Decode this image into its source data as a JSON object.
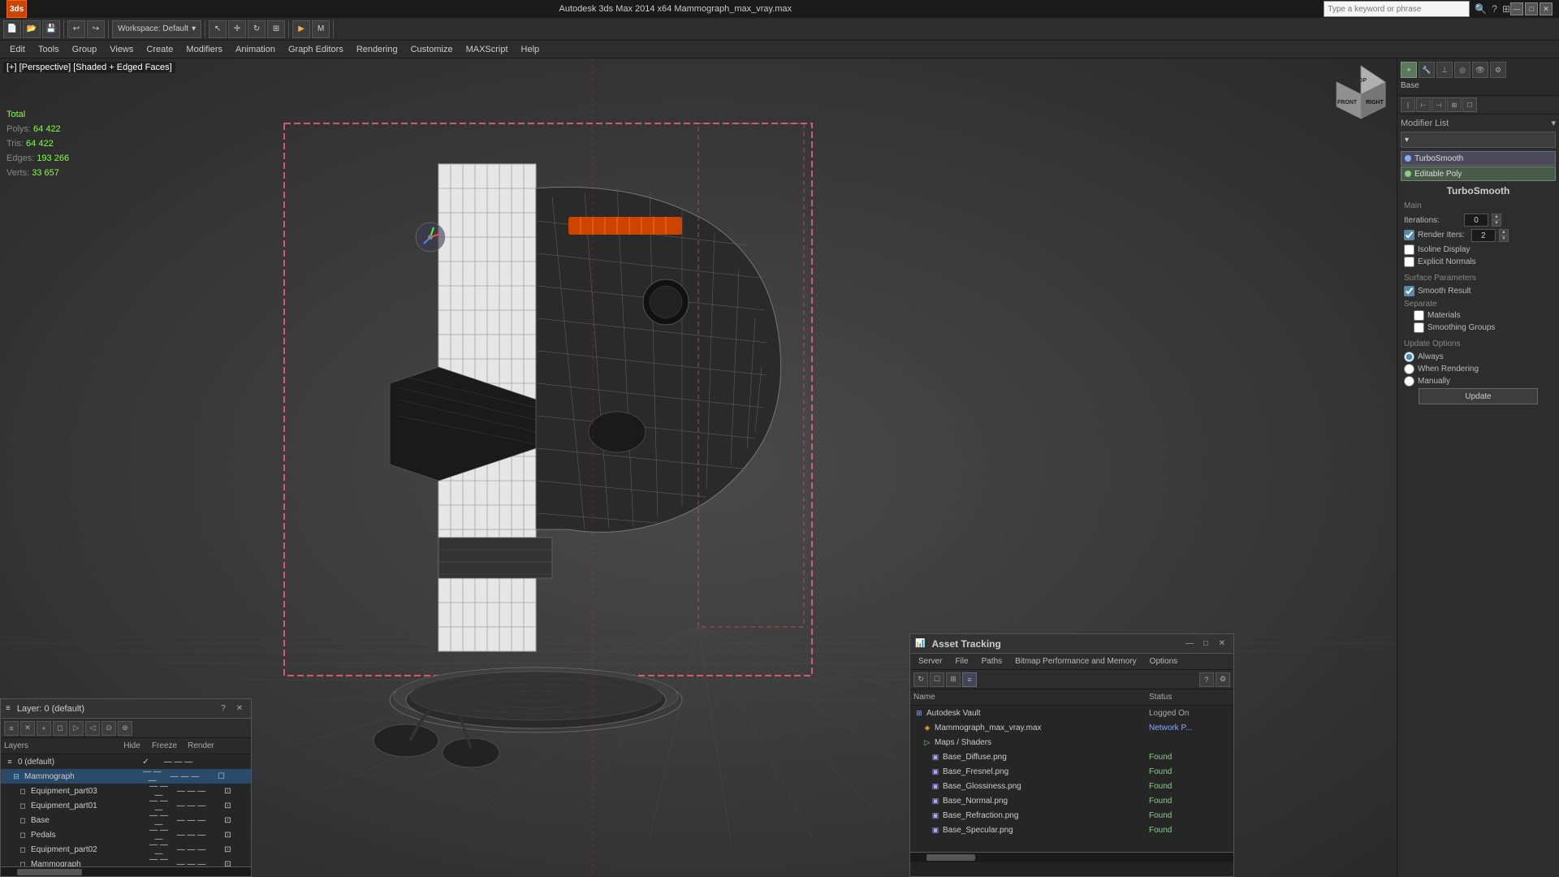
{
  "titlebar": {
    "title": "Autodesk 3ds Max 2014 x64    Mammograph_max_vray.max",
    "search_placeholder": "Type a keyword or phrase",
    "minimize": "—",
    "maximize": "□",
    "close": "✕"
  },
  "toolbar": {
    "workspace_label": "Workspace: Default",
    "dropdown_arrow": "▾"
  },
  "menubar": {
    "items": [
      "Edit",
      "Tools",
      "Group",
      "Views",
      "Create",
      "Modifiers",
      "Animation",
      "Graph Editors",
      "Rendering",
      "Customize",
      "MAXScript",
      "Help"
    ]
  },
  "viewport": {
    "label": "[+] [Perspective] [Shaded + Edged Faces]",
    "stats": {
      "polys_label": "Polys:",
      "polys_value": "64 422",
      "tris_label": "Tris:",
      "tris_value": "64 422",
      "edges_label": "Edges:",
      "edges_value": "193 266",
      "verts_label": "Verts:",
      "verts_value": "33 657",
      "total_label": "Total"
    }
  },
  "right_panel": {
    "base_label": "Base",
    "modifier_list_label": "Modifier List",
    "turbosmooth_label": "TurboSmooth",
    "editable_poly_label": "Editable Poly",
    "turbosmooth_title": "TurboSmooth",
    "main_section": "Main",
    "iterations_label": "Iterations:",
    "iterations_value": "0",
    "render_iters_label": "Render Iters:",
    "render_iters_value": "2",
    "isoline_label": "Isoline Display",
    "explicit_normals_label": "Explicit Normals",
    "surface_params_label": "Surface Parameters",
    "smooth_result_label": "Smooth Result",
    "separate_label": "Separate",
    "materials_label": "Materials",
    "smoothing_groups_label": "Smoothing Groups",
    "update_options_label": "Update Options",
    "always_label": "Always",
    "when_rendering_label": "When Rendering",
    "manually_label": "Manually",
    "update_btn": "Update"
  },
  "layer_panel": {
    "title": "Layer: 0 (default)",
    "help_btn": "?",
    "close_btn": "✕",
    "columns": {
      "layers": "Layers",
      "hide": "Hide",
      "freeze": "Freeze",
      "render": "Render"
    },
    "layers": [
      {
        "name": "0 (default)",
        "indent": 0,
        "selected": false,
        "checked": true
      },
      {
        "name": "Mammograph",
        "indent": 1,
        "selected": true
      },
      {
        "name": "Equipment_part03",
        "indent": 2,
        "selected": false
      },
      {
        "name": "Equipment_part01",
        "indent": 2,
        "selected": false
      },
      {
        "name": "Base",
        "indent": 2,
        "selected": false
      },
      {
        "name": "Pedals",
        "indent": 2,
        "selected": false
      },
      {
        "name": "Equipment_part02",
        "indent": 2,
        "selected": false
      },
      {
        "name": "Mammograph",
        "indent": 2,
        "selected": false
      }
    ]
  },
  "asset_panel": {
    "title": "Asset Tracking",
    "menu": [
      "Server",
      "File",
      "Paths",
      "Bitmap Performance and Memory",
      "Options"
    ],
    "columns": {
      "name": "Name",
      "status": "Status"
    },
    "items": [
      {
        "name": "Autodesk Vault",
        "indent": 0,
        "status": "Logged On",
        "type": "vault"
      },
      {
        "name": "Mammograph_max_vray.max",
        "indent": 1,
        "status": "Network P...",
        "type": "file"
      },
      {
        "name": "Maps / Shaders",
        "indent": 1,
        "status": "",
        "type": "folder"
      },
      {
        "name": "Base_Diffuse.png",
        "indent": 2,
        "status": "Found",
        "type": "image"
      },
      {
        "name": "Base_Fresnel.png",
        "indent": 2,
        "status": "Found",
        "type": "image"
      },
      {
        "name": "Base_Glossiness.png",
        "indent": 2,
        "status": "Found",
        "type": "image"
      },
      {
        "name": "Base_Normal.png",
        "indent": 2,
        "status": "Found",
        "type": "image"
      },
      {
        "name": "Base_Refraction.png",
        "indent": 2,
        "status": "Found",
        "type": "image"
      },
      {
        "name": "Base_Specular.png",
        "indent": 2,
        "status": "Found",
        "type": "image"
      }
    ]
  },
  "icons": {
    "arrow_up": "▲",
    "arrow_down": "▼",
    "check": "✓",
    "folder": "📁",
    "file": "📄",
    "image": "🖼",
    "chain": "🔗",
    "gear": "⚙",
    "camera": "📷",
    "light": "💡",
    "eye": "👁",
    "lock": "🔒",
    "plus": "+",
    "minus": "−",
    "close": "✕",
    "help": "?",
    "refresh": "↻",
    "search": "🔍"
  }
}
